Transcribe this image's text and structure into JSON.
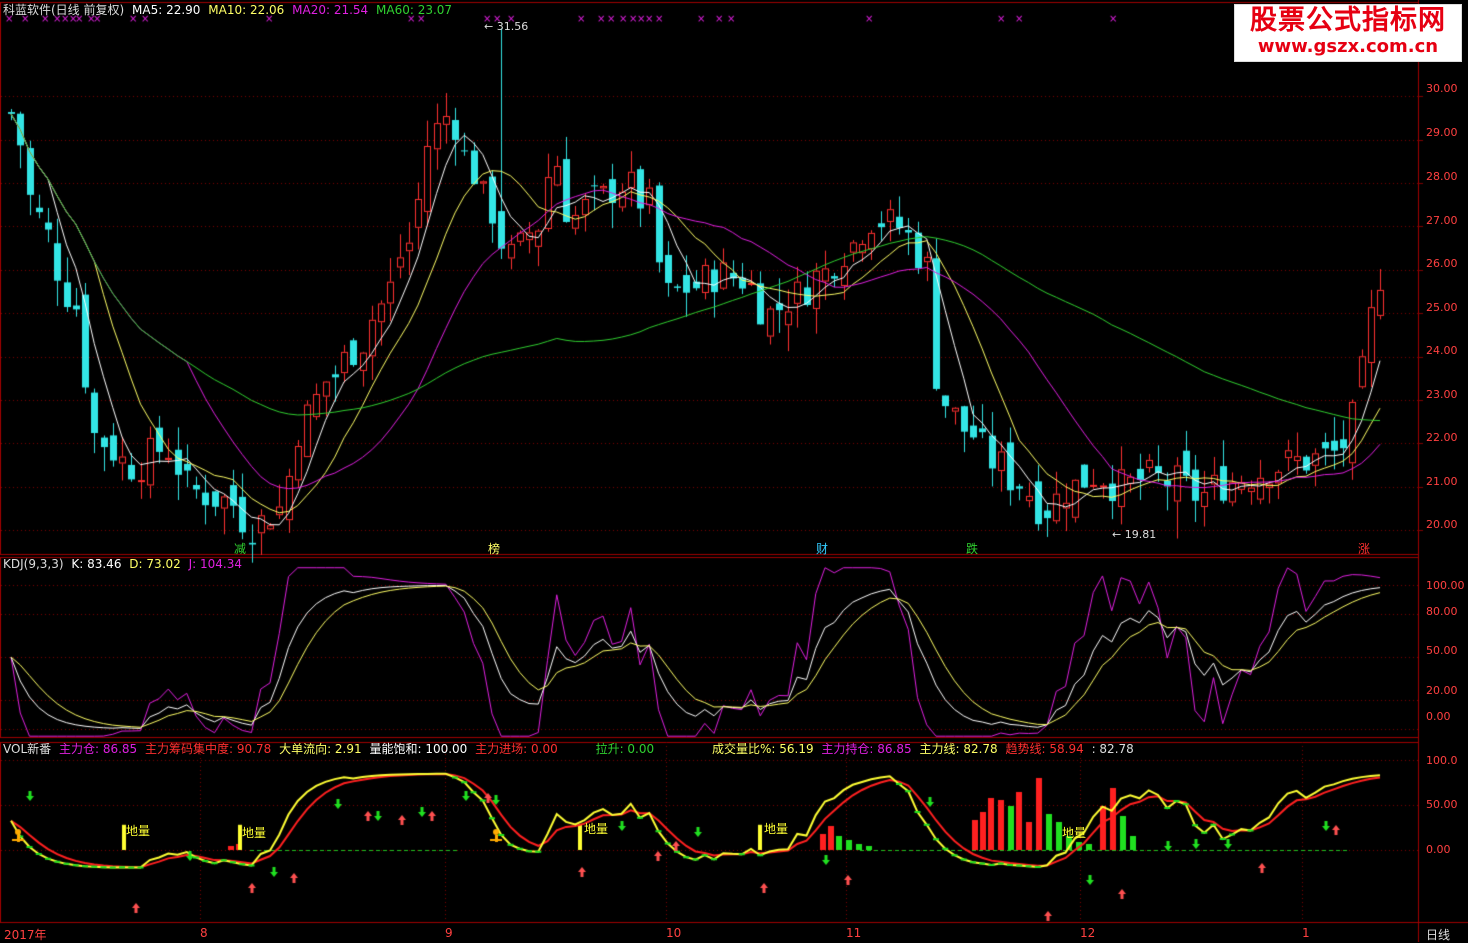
{
  "main_header": {
    "title": "科蓝软件(日线 前复权)",
    "ma5": "MA5: 22.90",
    "ma10": "MA10: 22.06",
    "ma20": "MA20: 21.54",
    "ma60": "MA60: 23.07"
  },
  "kdj_header": {
    "title": "KDJ(9,3,3)",
    "k": "K: 83.46",
    "d": "D: 73.02",
    "j": "J: 104.34"
  },
  "vol_header": {
    "title": "VOL新番",
    "items": [
      "主力仓: 86.85",
      "主力筹码集中度: 90.78",
      "大单流向: 2.91",
      "量能饱和: 100.00",
      "主力进场: 0.00",
      "拉升: 0.00",
      "成交量比%: 56.19",
      "主力持仓: 86.85",
      "主力线: 82.78",
      "趋势线: 58.94",
      ": 82.78"
    ]
  },
  "watermark": {
    "line1": "股票公式指标网",
    "line2": "www.gszx.com.cn"
  },
  "price_axis": [
    "30.00",
    "29.00",
    "28.00",
    "27.00",
    "26.00",
    "25.00",
    "24.00",
    "23.00",
    "22.00",
    "21.00",
    "20.00"
  ],
  "kdj_axis": [
    "100.00",
    "80.00",
    "50.00",
    "20.00",
    "0.00"
  ],
  "vol_axis": [
    "100.0",
    "50.00",
    "0.00"
  ],
  "date_axis": [
    "2017年",
    "8",
    "9",
    "10",
    "11",
    "12",
    "1"
  ],
  "period_label": "日线",
  "annotations": {
    "high": "31.56",
    "low": "19.81"
  },
  "events": [
    "减",
    "榜",
    "财",
    "跌",
    "涨"
  ],
  "zone_label": "地量",
  "colors": {
    "up": "#ff3030",
    "down": "#33e5e5",
    "ma5": "#ffffff",
    "ma10": "#ffff66",
    "ma20": "#e020e0",
    "ma60": "#30d030",
    "grid": "#800000",
    "k": "#ffffff",
    "d": "#ffff66",
    "j": "#e020e0"
  },
  "chart_data": [
    {
      "type": "candlestick",
      "title": "科蓝软件(日线 前复权)",
      "ylim": [
        19.5,
        31.8
      ],
      "series_note": "MA5, MA10, MA20, MA60 overlays",
      "high": 31.56,
      "low": 19.81
    },
    {
      "type": "line",
      "title": "KDJ(9,3,3)",
      "ylim": [
        -5,
        115
      ],
      "last": {
        "K": 83.46,
        "D": 73.02,
        "J": 104.34
      }
    },
    {
      "type": "line",
      "title": "VOL新番",
      "ylim": [
        -70,
        110
      ]
    }
  ]
}
